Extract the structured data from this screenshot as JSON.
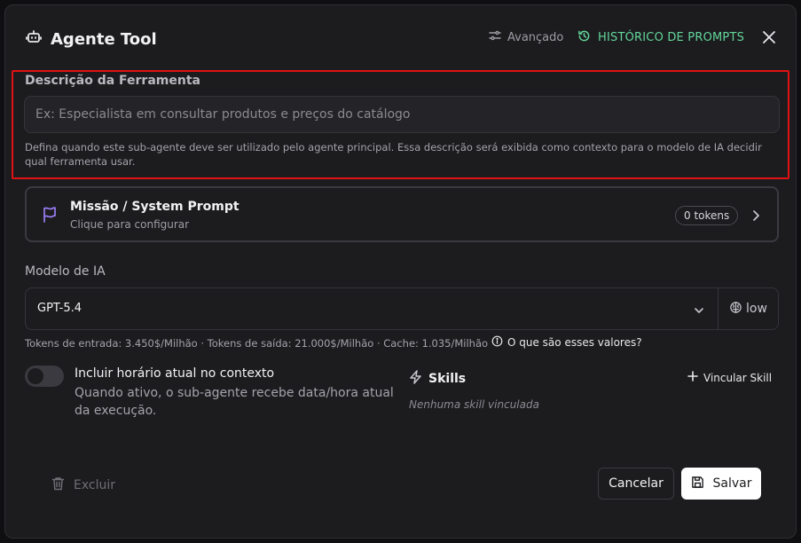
{
  "header": {
    "title": "Agente Tool",
    "advanced_label": "Avançado",
    "history_label": "HISTÓRICO DE PROMPTS"
  },
  "description": {
    "label": "Descrição da Ferramenta",
    "placeholder": "Ex: Especialista em consultar produtos e preços do catálogo",
    "value": "",
    "help": "Defina quando este sub-agente deve ser utilizado pelo agente principal. Essa descrição será exibida como contexto para o modelo de IA decidir qual ferramenta usar."
  },
  "mission": {
    "title": "Missão / System Prompt",
    "subtitle": "Clique para configurar",
    "tokens": "0 tokens"
  },
  "model": {
    "label": "Modelo de IA",
    "selected": "GPT-5.4",
    "effort": "low",
    "pricing": "Tokens de entrada: 3.450$/Milhão · Tokens de saída: 21.000$/Milhão · Cache: 1.035/Milhão",
    "info_link": "O que são esses valores?"
  },
  "time_toggle": {
    "title": "Incluir horário atual no contexto",
    "description": "Quando ativo, o sub-agente recebe data/hora atual da execução.",
    "enabled": false
  },
  "skills": {
    "title": "Skills",
    "link_button": "Vincular Skill",
    "empty": "Nenhuma skill vinculada"
  },
  "footer": {
    "delete_label": "Excluir",
    "cancel_label": "Cancelar",
    "save_label": "Salvar"
  },
  "colors": {
    "accent_green": "#63d69a",
    "highlight_red": "#e01212",
    "flag_purple": "#9b7ef5"
  }
}
